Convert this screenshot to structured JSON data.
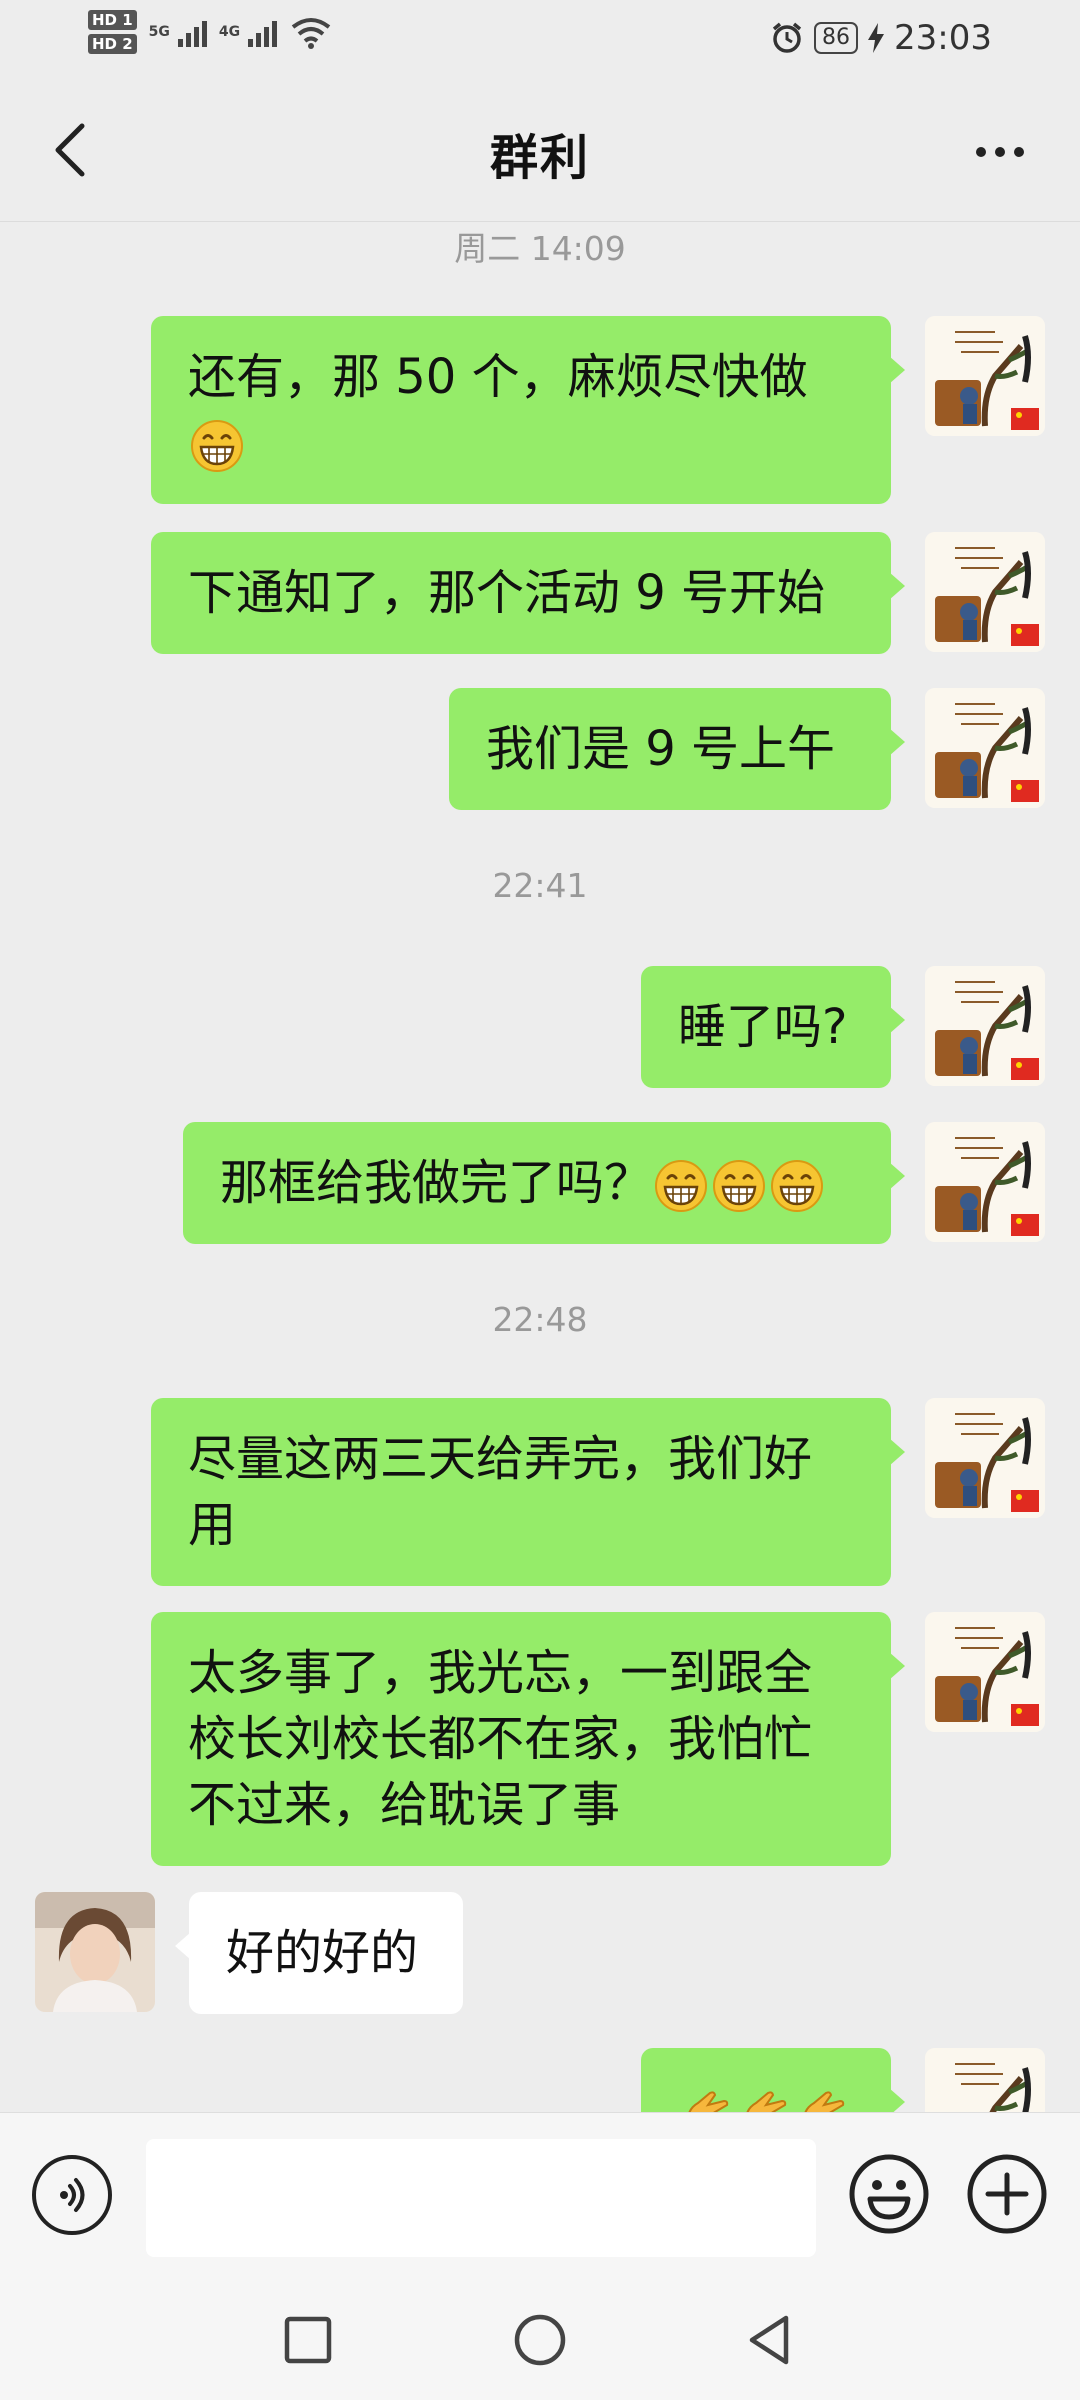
{
  "status_bar": {
    "sim1": "HD 1",
    "sim2": "HD 2",
    "net1": "5G",
    "net2": "4G",
    "battery": "86",
    "time": "23:03"
  },
  "header": {
    "title": "群利",
    "back_icon": "chevron-left-icon",
    "more_icon": "more-dots-icon"
  },
  "messages": [
    {
      "type": "time",
      "text": "周二 14:09"
    },
    {
      "type": "self",
      "text": "还有，那 50 个，麻烦尽快做",
      "emojis": 1
    },
    {
      "type": "self",
      "text": "下通知了，那个活动 9 号开始"
    },
    {
      "type": "self",
      "text": "我们是 9 号上午"
    },
    {
      "type": "time",
      "text": "22:41"
    },
    {
      "type": "self",
      "text": "睡了吗?"
    },
    {
      "type": "self",
      "text": "那框给我做完了吗？",
      "emojis": 3
    },
    {
      "type": "time",
      "text": "22:48"
    },
    {
      "type": "self",
      "text": "尽量这两三天给弄完，我们好用"
    },
    {
      "type": "self",
      "text": "太多事了，我光忘，一到跟全校长刘校长都不在家，我怕忙不过来，给耽误了事"
    },
    {
      "type": "other",
      "text": "好的好的"
    },
    {
      "type": "self",
      "text": "",
      "emojis": 3
    }
  ],
  "input_bar": {
    "voice_icon": "voice-icon",
    "input_value": "",
    "emoji_icon": "smiley-icon",
    "plus_icon": "plus-icon"
  },
  "nav": {
    "recents_icon": "square-icon",
    "home_icon": "circle-icon",
    "back_icon": "triangle-back-icon"
  },
  "colors": {
    "self_bubble": "#95ec69",
    "other_bubble": "#ffffff",
    "background": "#ededed"
  }
}
